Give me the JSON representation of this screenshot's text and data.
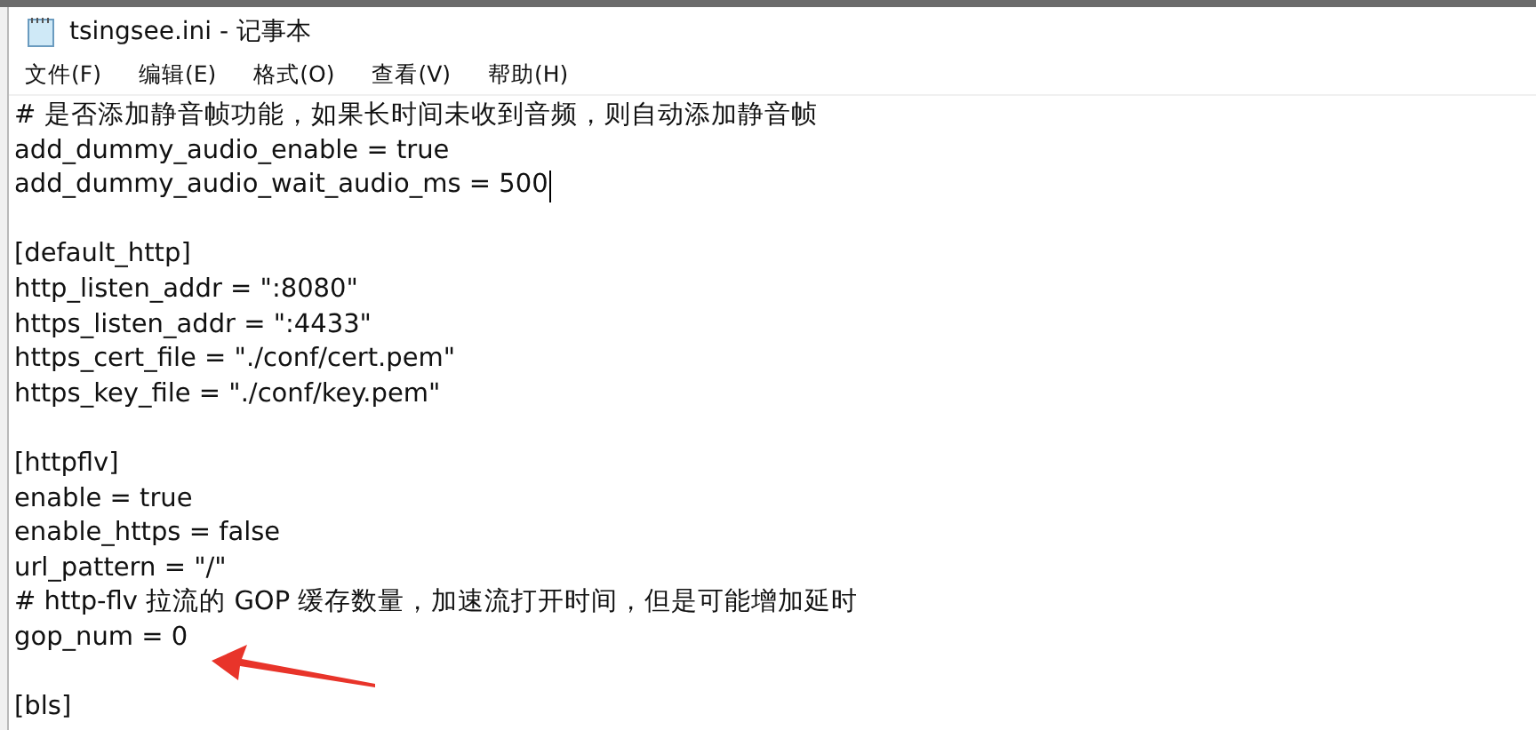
{
  "window": {
    "title": "tsingsee.ini - 记事本"
  },
  "menu": [
    "文件(F)",
    "编辑(E)",
    "格式(O)",
    "查看(V)",
    "帮助(H)"
  ],
  "lines": [
    {
      "kind": "text",
      "text": "# 是否添加静音帧功能，如果长时间未收到音频，则自动添加静音帧",
      "cursor": false
    },
    {
      "kind": "text",
      "text": "add_dummy_audio_enable = true",
      "cursor": false
    },
    {
      "kind": "text",
      "text": "add_dummy_audio_wait_audio_ms = 500",
      "cursor": true
    },
    {
      "kind": "blank"
    },
    {
      "kind": "text",
      "text": "[default_http]",
      "cursor": false
    },
    {
      "kind": "text",
      "text": "http_listen_addr = \":8080\"",
      "cursor": false
    },
    {
      "kind": "text",
      "text": "https_listen_addr = \":4433\"",
      "cursor": false
    },
    {
      "kind": "text",
      "text": "https_cert_file = \"./conf/cert.pem\"",
      "cursor": false
    },
    {
      "kind": "text",
      "text": "https_key_file = \"./conf/key.pem\"",
      "cursor": false
    },
    {
      "kind": "blank"
    },
    {
      "kind": "text",
      "text": "[httpflv]",
      "cursor": false
    },
    {
      "kind": "text",
      "text": "enable = true",
      "cursor": false
    },
    {
      "kind": "text",
      "text": "enable_https = false",
      "cursor": false
    },
    {
      "kind": "text",
      "text": "url_pattern = \"/\"",
      "cursor": false
    },
    {
      "kind": "text",
      "text": "# http-flv 拉流的 GOP 缓存数量，加速流打开时间，但是可能增加延时",
      "cursor": false
    },
    {
      "kind": "text",
      "text": "gop_num = 0",
      "cursor": false
    },
    {
      "kind": "blank"
    },
    {
      "kind": "text",
      "text": "[bls]",
      "cursor": false
    }
  ]
}
